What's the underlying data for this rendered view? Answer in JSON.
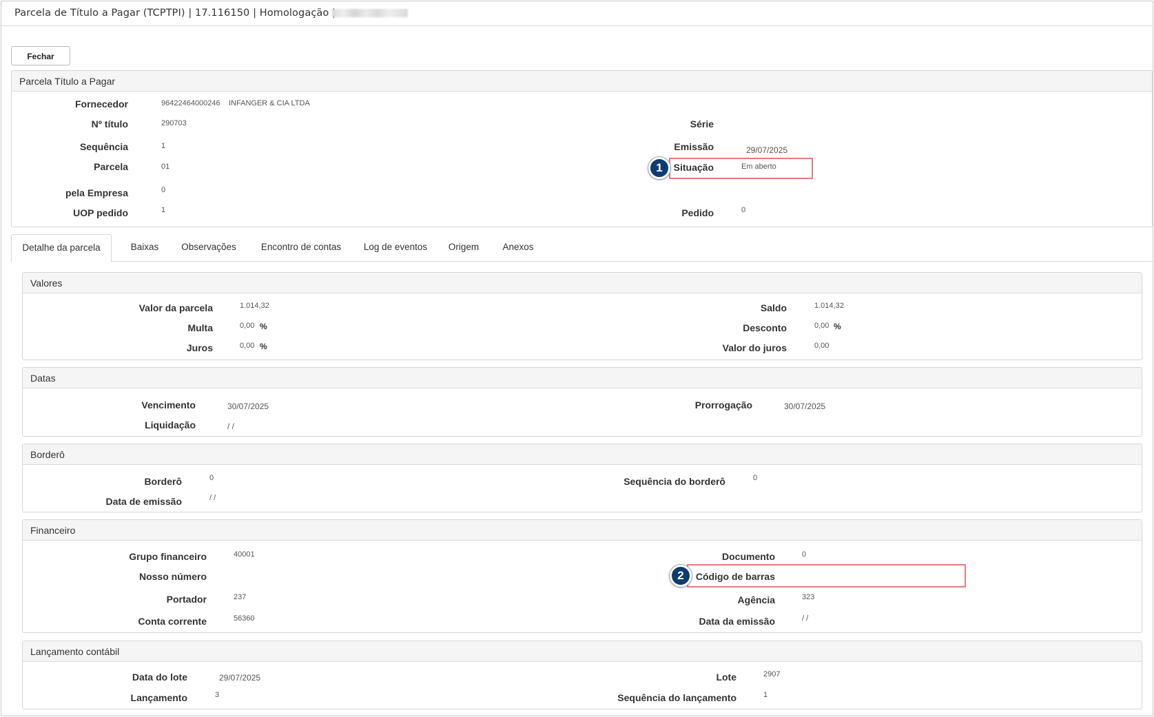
{
  "window": {
    "title": "Parcela de Título a Pagar (TCPTPI) | 17.116150 | Homologação |"
  },
  "toolbar": {
    "close_label": "Fechar"
  },
  "header": {
    "title": "Parcela Título a Pagar",
    "fornecedor_label": "Fornecedor",
    "fornecedor_code": "96422464000246",
    "fornecedor_name": "INFANGER & CIA LTDA",
    "titulo_label": "Nº título",
    "titulo_value": "290703",
    "serie_label": "Série",
    "serie_value": "",
    "sequencia_label": "Sequência",
    "sequencia_value": "1",
    "emissao_label": "Emissão",
    "emissao_value": "29/07/2025",
    "parcela_label": "Parcela",
    "parcela_value": "01",
    "situacao_label": "Situação",
    "situacao_value": "Em aberto",
    "empresa_label": "pela Empresa",
    "empresa_value": "0",
    "uop_label": "UOP pedido",
    "uop_value": "1",
    "pedido_label": "Pedido",
    "pedido_value": "0"
  },
  "tabs": [
    {
      "label": "Detalhe da parcela",
      "active": true
    },
    {
      "label": "Baixas"
    },
    {
      "label": "Observações"
    },
    {
      "label": "Encontro de contas"
    },
    {
      "label": "Log de eventos"
    },
    {
      "label": "Origem"
    },
    {
      "label": "Anexos"
    }
  ],
  "valores": {
    "title": "Valores",
    "valor_parcela_label": "Valor da parcela",
    "valor_parcela_value": "1.014,32",
    "saldo_label": "Saldo",
    "saldo_value": "1.014,32",
    "multa_label": "Multa",
    "multa_value": "0,00",
    "desconto_label": "Desconto",
    "desconto_value": "0,00",
    "juros_label": "Juros",
    "juros_value": "0,00",
    "valor_juros_label": "Valor do juros",
    "valor_juros_value": "0,00",
    "percent": "%"
  },
  "datas": {
    "title": "Datas",
    "vencimento_label": "Vencimento",
    "vencimento_value": "30/07/2025",
    "prorrogacao_label": "Prorrogação",
    "prorrogacao_value": "30/07/2025",
    "liquidacao_label": "Liquidação",
    "liquidacao_value": "/ /"
  },
  "bordero": {
    "title": "Borderô",
    "bordero_label": "Borderô",
    "bordero_value": "0",
    "seq_bordero_label": "Sequência do borderô",
    "seq_bordero_value": "0",
    "data_emissao_label": "Data de emissão",
    "data_emissao_value": "/ /"
  },
  "financeiro": {
    "title": "Financeiro",
    "grupo_label": "Grupo financeiro",
    "grupo_value": "40001",
    "documento_label": "Documento",
    "documento_value": "0",
    "nosso_numero_label": "Nosso número",
    "nosso_numero_value": "",
    "codigo_barras_label": "Código de barras",
    "codigo_barras_value": "",
    "portador_label": "Portador",
    "portador_value": "237",
    "agencia_label": "Agência",
    "agencia_value": "323",
    "conta_label": "Conta corrente",
    "conta_value": "56360",
    "data_emissao_label": "Data da emissão",
    "data_emissao_value": "/ /"
  },
  "lancamento": {
    "title": "Lançamento contábil",
    "data_lote_label": "Data do lote",
    "data_lote_value": "29/07/2025",
    "lote_label": "Lote",
    "lote_value": "2907",
    "lancamento_label": "Lançamento",
    "lancamento_value": "3",
    "seq_lancamento_label": "Sequência do lançamento",
    "seq_lancamento_value": "1"
  },
  "callouts": {
    "one": "1",
    "two": "2",
    "highlight_color": "#e8797a",
    "badge_color": "#0f3c6e"
  }
}
